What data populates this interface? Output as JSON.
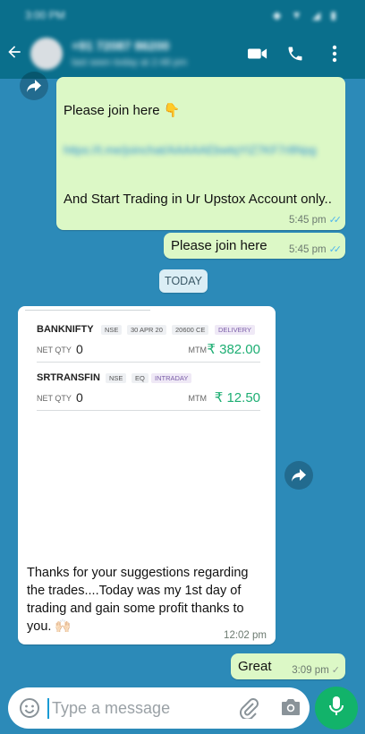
{
  "status_bar": {
    "time": "3:00 PM",
    "icons": "◆ ▼ ◢ ▮"
  },
  "header": {
    "contact_name": "+91 72087 86200",
    "contact_status": "last seen today at 2:48 pm"
  },
  "messages": {
    "m1": {
      "text1": "Please join here 👇",
      "link": "https://t.me/joinchat/AAAAAEbwtqYIZ7KF7r8Npg",
      "text2": "And Start Trading in Ur Upstox Account only..",
      "time": "5:45 pm",
      "ticks": "✓✓"
    },
    "m2": {
      "text": "Please join here",
      "time": "5:45 pm",
      "ticks": "✓✓"
    },
    "date_chip": "TODAY",
    "m3": {
      "positions": [
        {
          "symbol": "BANKNIFTY",
          "tags": [
            "NSE",
            "30 APR 20",
            "20600 CE",
            "DELIVERY"
          ],
          "net_label": "NET QTY",
          "net_qty": "0",
          "mtm_label": "MTM",
          "mtm_value": "₹ 382.00"
        },
        {
          "symbol": "SRTRANSFIN",
          "tags": [
            "NSE",
            "EQ",
            "INTRADAY"
          ],
          "net_label": "NET QTY",
          "net_qty": "0",
          "mtm_label": "MTM",
          "mtm_value": "₹ 12.50"
        }
      ],
      "text": "Thanks for your suggestions regarding the trades....Today was my 1st day of trading and gain some profit thanks to you. 🙌🏻",
      "time": "12:02 pm"
    },
    "m4": {
      "text": "Great",
      "time": "3:09 pm",
      "ticks": "✓"
    }
  },
  "input": {
    "placeholder": "Type a message"
  },
  "colors": {
    "chat_bg": "#2c8ab8",
    "header_bg": "#0a6f8c",
    "outgoing": "#dcf8c6",
    "incoming": "#ffffff",
    "mic": "#12b36a"
  },
  "icons": [
    "arrow-back-icon",
    "video-icon",
    "phone-icon",
    "menu-icon",
    "forward-icon",
    "emoji-icon",
    "attach-icon",
    "camera-icon",
    "mic-icon"
  ]
}
